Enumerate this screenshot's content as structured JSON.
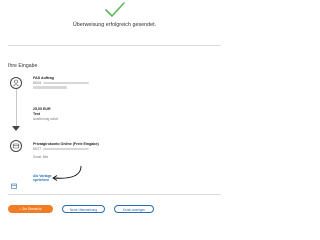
{
  "status": {
    "icon": "checkmark-icon",
    "title": "Überweisung erfolgreich gesendet."
  },
  "section_title": "Ihre Eingabe",
  "sender": {
    "icon": "user-icon",
    "name": "FAD Auftrag",
    "iban_prefix": "DE08"
  },
  "transfer": {
    "amount": "25,00 EUR",
    "reference": "Test",
    "execution": "Ausführung sofort"
  },
  "recipient": {
    "icon": "card-icon",
    "name": "Privatgirokonto Online (Freie Eingabe)",
    "iban_prefix": "DE27",
    "bank": "Sonst. Bkk"
  },
  "save_template": {
    "icon": "calendar-icon",
    "line1": "Als Vorlage",
    "line2": "speichern"
  },
  "buttons": {
    "overview": "Zur Übersicht",
    "new_transfer": "Neue Überweisung",
    "show_account": "Konto anzeigen"
  },
  "colors": {
    "accent": "#f07c25",
    "link": "#2a6db5",
    "success": "#5cb85c"
  }
}
